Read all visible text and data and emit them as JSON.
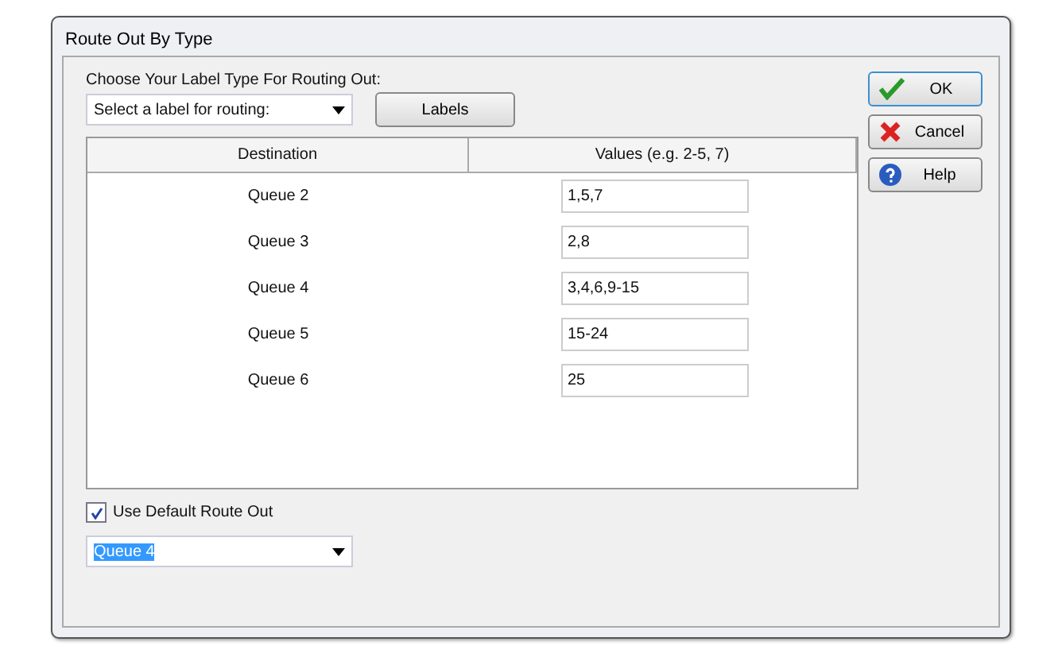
{
  "window": {
    "title": "Route Out By Type"
  },
  "label_type": {
    "label": "Choose Your Label Type For Routing Out:",
    "value": "Select a label for routing:",
    "labels_button": "Labels"
  },
  "table": {
    "columns": [
      "Destination",
      "Values (e.g. 2-5, 7)"
    ],
    "rows": [
      {
        "destination": "Queue 2",
        "values": "1,5,7"
      },
      {
        "destination": "Queue 3",
        "values": "2,8"
      },
      {
        "destination": "Queue 4",
        "values": "3,4,6,9-15"
      },
      {
        "destination": "Queue 5",
        "values": "15-24"
      },
      {
        "destination": "Queue 6",
        "values": "25"
      }
    ]
  },
  "default_route": {
    "label": "Use Default Route Out",
    "checked": true,
    "value": "Queue 4"
  },
  "buttons": [
    {
      "kind": "ok",
      "label": "OK"
    },
    {
      "kind": "cancel",
      "label": "Cancel"
    },
    {
      "kind": "help",
      "label": "Help"
    }
  ]
}
